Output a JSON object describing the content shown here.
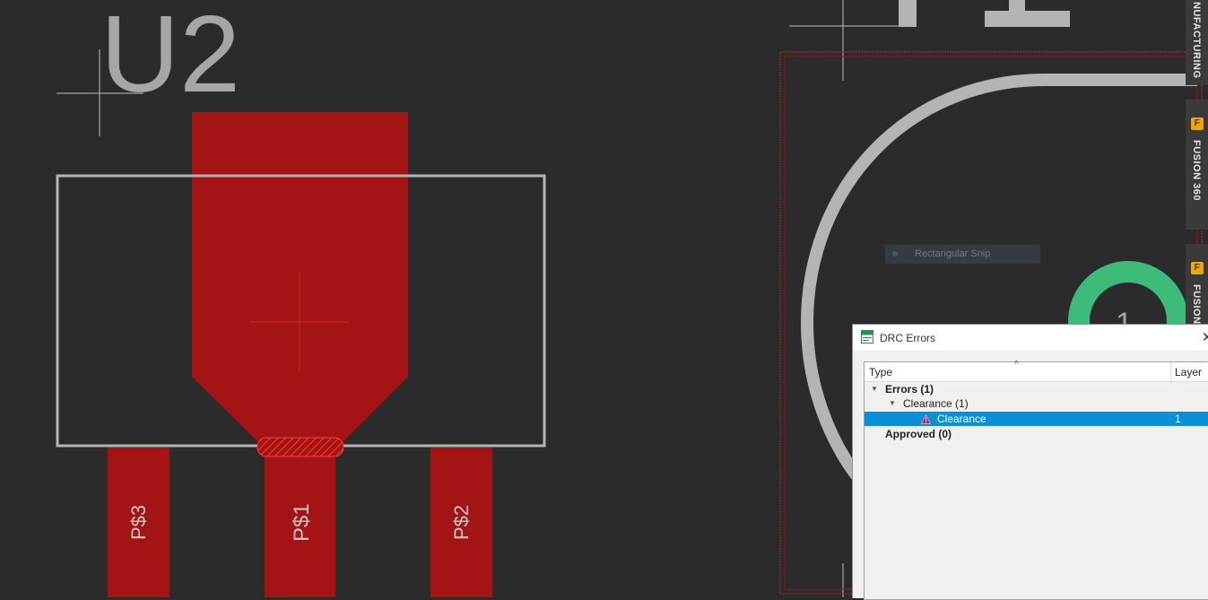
{
  "pcb": {
    "ref_designator": "U2",
    "pads": [
      "P$3",
      "P$1",
      "P$2"
    ],
    "via_label": "1",
    "colors": {
      "background": "#2b2b2b",
      "copper": "#a51414",
      "silk": "#b4b4b4",
      "via": "#3cbb7a"
    }
  },
  "side_tabs": {
    "manufacturing": "NUFACTURING",
    "fusion360": "FUSION 360",
    "fusion_partial": "FUSION",
    "fusion_icon": "F"
  },
  "snip_overlay": {
    "label": "Rectangular Snip"
  },
  "drc_dialog": {
    "title": "DRC Errors",
    "close_label": "✕",
    "columns": {
      "type": "Type",
      "layer": "Layer"
    },
    "rows": [
      {
        "label": "Errors (1)",
        "layer": ""
      },
      {
        "label": "Clearance (1)",
        "layer": ""
      },
      {
        "label": "Clearance",
        "layer": "1"
      },
      {
        "label": "Approved (0)",
        "layer": ""
      }
    ]
  }
}
